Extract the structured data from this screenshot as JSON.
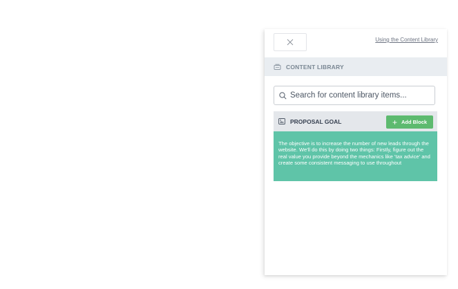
{
  "header": {
    "close_label": "×",
    "help_link": "Using the Content Library"
  },
  "section": {
    "icon": "library-icon",
    "title": "CONTENT LIBRARY"
  },
  "search": {
    "placeholder": "Search for content library items...",
    "value": ""
  },
  "item": {
    "icon": "image-block-icon",
    "title": "PROPOSAL GOAL",
    "add_button": "Add Block",
    "body": "The objective is to increase the number of new leads through the website. We'll do this by doing two things: Firstly, figure out the real value you provide beyond the mechanics like 'tax advice' and create some consistent messaging to use throughout"
  },
  "colors": {
    "add_button": "#5dba6f",
    "item_body": "#5fc4a8",
    "section_bar": "#e9edf1"
  }
}
